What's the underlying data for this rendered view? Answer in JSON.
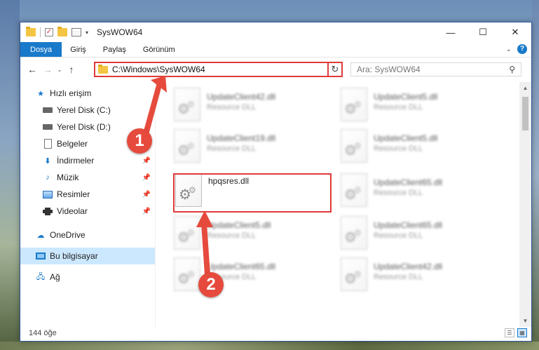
{
  "window": {
    "title": "SysWOW64",
    "controls": {
      "minimize": "—",
      "maximize": "☐",
      "close": "✕"
    }
  },
  "ribbon": {
    "tabs": [
      "Dosya",
      "Giriş",
      "Paylaş",
      "Görünüm"
    ],
    "collapse": "⌄",
    "help": "?"
  },
  "nav": {
    "back": "←",
    "forward": "→",
    "recent": "⌄",
    "up": "↑",
    "address": "C:\\Windows\\SysWOW64",
    "address_dropdown": "⌄",
    "refresh": "↻",
    "search_placeholder": "Ara: SysWOW64",
    "search_icon": "⚲"
  },
  "sidebar": {
    "items": [
      {
        "label": "Hızlı erişim",
        "icon": "star-icon",
        "pinned": false
      },
      {
        "label": "Yerel Disk (C:)",
        "icon": "drive-icon",
        "pinned": false
      },
      {
        "label": "Yerel Disk (D:)",
        "icon": "drive-icon",
        "pinned": false
      },
      {
        "label": "Belgeler",
        "icon": "documents-icon",
        "pinned": false
      },
      {
        "label": "İndirmeler",
        "icon": "downloads-icon",
        "pinned": true
      },
      {
        "label": "Müzik",
        "icon": "music-icon",
        "pinned": true
      },
      {
        "label": "Resimler",
        "icon": "pictures-icon",
        "pinned": true
      },
      {
        "label": "Videolar",
        "icon": "videos-icon",
        "pinned": true
      },
      {
        "label": "OneDrive",
        "icon": "cloud-icon",
        "pinned": false
      },
      {
        "label": "Bu bilgisayar",
        "icon": "computer-icon",
        "pinned": false,
        "selected": true
      },
      {
        "label": "Ağ",
        "icon": "network-icon",
        "pinned": false
      }
    ],
    "pin_glyph": "📌"
  },
  "files": {
    "highlighted": {
      "name": "hpqsres.dll"
    },
    "blurred": [
      {
        "name": "UpdateClient42.dll",
        "type": "Resource DLL"
      },
      {
        "name": "UpdateClient5.dll",
        "type": "Resource DLL"
      },
      {
        "name": "UpdateClient19.dll",
        "type": "Resource DLL"
      },
      {
        "name": "UpdateClient5.dll",
        "type": "Resource DLL"
      },
      {
        "name": "UpdateClient65.dll",
        "type": "Resource DLL"
      },
      {
        "name": "UpdateClient5.dll",
        "type": "Resource DLL"
      },
      {
        "name": "UpdateClient65.dll",
        "type": "Resource DLL"
      },
      {
        "name": "UpdateClient65.dll",
        "type": "Resource DLL"
      },
      {
        "name": "UpdateClient42.dll",
        "type": "Resource DLL"
      }
    ]
  },
  "status": {
    "count": "144 öğe"
  },
  "callouts": {
    "one": "1",
    "two": "2"
  },
  "colors": {
    "accent": "#1979ca",
    "highlight": "#e03a3a",
    "callout": "#e64a3c"
  }
}
